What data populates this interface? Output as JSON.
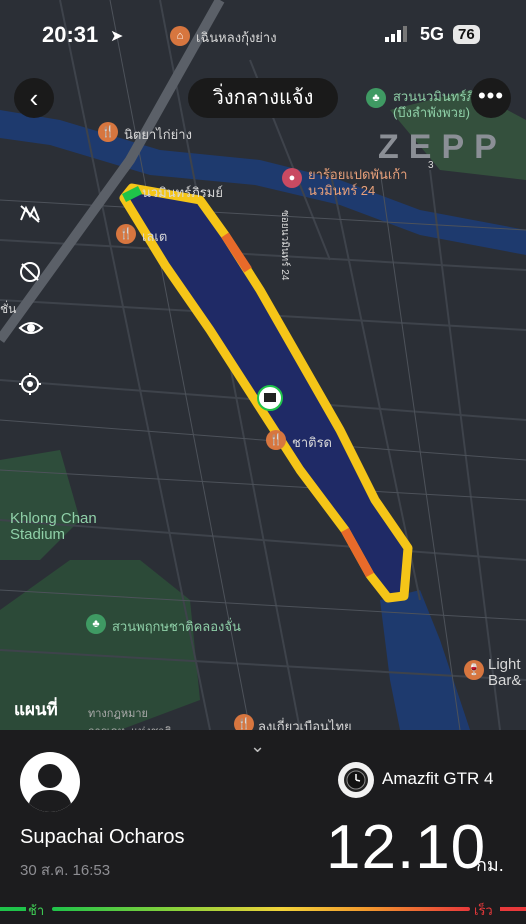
{
  "status_bar": {
    "time": "20:31",
    "network": "5G",
    "battery": "76"
  },
  "header": {
    "title": "วิ่งกลางแจ้ง",
    "brand": "ZEPP"
  },
  "map": {
    "labels": {
      "l1": "เฉินหลงกุ้งย่าง",
      "l2": "สวนนวมินทร์ภิรมย์",
      "l3": "(บึงลำพังพวย)",
      "l4": "นิตยาไก่ย่าง",
      "l5": "ยาร้อยแปดพันเก้า",
      "l6": "นวมินทร์ 24",
      "l7": "นวมินทร์ภิรมย์",
      "l8": "เลเต",
      "l9": "ซอยนวมินทร์ 24",
      "l10": "Khlong Chan",
      "l11": "Stadium",
      "l12": "สวนพฤกษชาติคลองจั่น",
      "l13": "Light",
      "l14": "Bar&",
      "l15": "ชาติรด",
      "l16": "ลงเกี่ยวเบือนไทย",
      "l17": "ชั่น",
      "l18": "3"
    },
    "attribution": "แผนที่",
    "legal": "ทางกฎหมาย",
    "legal2": "การเคหะแห่งชาติ"
  },
  "summary": {
    "user_name": "Supachai Ocharos",
    "date": "30 ส.ค. 16:53",
    "device": "Amazfit GTR 4",
    "distance": "12.10",
    "unit": "กม.",
    "slow_label": "ช้า",
    "fast_label": "เร็ว"
  },
  "colors": {
    "route_main": "#f5c518",
    "route_fast": "#e8393b",
    "route_slow": "#1fc34a",
    "lake": "#1f2a66"
  }
}
